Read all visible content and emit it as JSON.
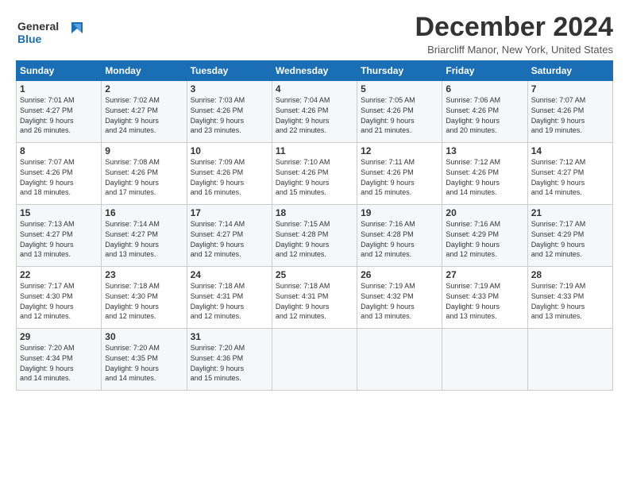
{
  "logo": {
    "line1": "General",
    "line2": "Blue"
  },
  "title": "December 2024",
  "location": "Briarcliff Manor, New York, United States",
  "weekdays": [
    "Sunday",
    "Monday",
    "Tuesday",
    "Wednesday",
    "Thursday",
    "Friday",
    "Saturday"
  ],
  "weeks": [
    [
      {
        "day": "1",
        "info": "Sunrise: 7:01 AM\nSunset: 4:27 PM\nDaylight: 9 hours\nand 26 minutes."
      },
      {
        "day": "2",
        "info": "Sunrise: 7:02 AM\nSunset: 4:27 PM\nDaylight: 9 hours\nand 24 minutes."
      },
      {
        "day": "3",
        "info": "Sunrise: 7:03 AM\nSunset: 4:26 PM\nDaylight: 9 hours\nand 23 minutes."
      },
      {
        "day": "4",
        "info": "Sunrise: 7:04 AM\nSunset: 4:26 PM\nDaylight: 9 hours\nand 22 minutes."
      },
      {
        "day": "5",
        "info": "Sunrise: 7:05 AM\nSunset: 4:26 PM\nDaylight: 9 hours\nand 21 minutes."
      },
      {
        "day": "6",
        "info": "Sunrise: 7:06 AM\nSunset: 4:26 PM\nDaylight: 9 hours\nand 20 minutes."
      },
      {
        "day": "7",
        "info": "Sunrise: 7:07 AM\nSunset: 4:26 PM\nDaylight: 9 hours\nand 19 minutes."
      }
    ],
    [
      {
        "day": "8",
        "info": "Sunrise: 7:07 AM\nSunset: 4:26 PM\nDaylight: 9 hours\nand 18 minutes."
      },
      {
        "day": "9",
        "info": "Sunrise: 7:08 AM\nSunset: 4:26 PM\nDaylight: 9 hours\nand 17 minutes."
      },
      {
        "day": "10",
        "info": "Sunrise: 7:09 AM\nSunset: 4:26 PM\nDaylight: 9 hours\nand 16 minutes."
      },
      {
        "day": "11",
        "info": "Sunrise: 7:10 AM\nSunset: 4:26 PM\nDaylight: 9 hours\nand 15 minutes."
      },
      {
        "day": "12",
        "info": "Sunrise: 7:11 AM\nSunset: 4:26 PM\nDaylight: 9 hours\nand 15 minutes."
      },
      {
        "day": "13",
        "info": "Sunrise: 7:12 AM\nSunset: 4:26 PM\nDaylight: 9 hours\nand 14 minutes."
      },
      {
        "day": "14",
        "info": "Sunrise: 7:12 AM\nSunset: 4:27 PM\nDaylight: 9 hours\nand 14 minutes."
      }
    ],
    [
      {
        "day": "15",
        "info": "Sunrise: 7:13 AM\nSunset: 4:27 PM\nDaylight: 9 hours\nand 13 minutes."
      },
      {
        "day": "16",
        "info": "Sunrise: 7:14 AM\nSunset: 4:27 PM\nDaylight: 9 hours\nand 13 minutes."
      },
      {
        "day": "17",
        "info": "Sunrise: 7:14 AM\nSunset: 4:27 PM\nDaylight: 9 hours\nand 12 minutes."
      },
      {
        "day": "18",
        "info": "Sunrise: 7:15 AM\nSunset: 4:28 PM\nDaylight: 9 hours\nand 12 minutes."
      },
      {
        "day": "19",
        "info": "Sunrise: 7:16 AM\nSunset: 4:28 PM\nDaylight: 9 hours\nand 12 minutes."
      },
      {
        "day": "20",
        "info": "Sunrise: 7:16 AM\nSunset: 4:29 PM\nDaylight: 9 hours\nand 12 minutes."
      },
      {
        "day": "21",
        "info": "Sunrise: 7:17 AM\nSunset: 4:29 PM\nDaylight: 9 hours\nand 12 minutes."
      }
    ],
    [
      {
        "day": "22",
        "info": "Sunrise: 7:17 AM\nSunset: 4:30 PM\nDaylight: 9 hours\nand 12 minutes."
      },
      {
        "day": "23",
        "info": "Sunrise: 7:18 AM\nSunset: 4:30 PM\nDaylight: 9 hours\nand 12 minutes."
      },
      {
        "day": "24",
        "info": "Sunrise: 7:18 AM\nSunset: 4:31 PM\nDaylight: 9 hours\nand 12 minutes."
      },
      {
        "day": "25",
        "info": "Sunrise: 7:18 AM\nSunset: 4:31 PM\nDaylight: 9 hours\nand 12 minutes."
      },
      {
        "day": "26",
        "info": "Sunrise: 7:19 AM\nSunset: 4:32 PM\nDaylight: 9 hours\nand 13 minutes."
      },
      {
        "day": "27",
        "info": "Sunrise: 7:19 AM\nSunset: 4:33 PM\nDaylight: 9 hours\nand 13 minutes."
      },
      {
        "day": "28",
        "info": "Sunrise: 7:19 AM\nSunset: 4:33 PM\nDaylight: 9 hours\nand 13 minutes."
      }
    ],
    [
      {
        "day": "29",
        "info": "Sunrise: 7:20 AM\nSunset: 4:34 PM\nDaylight: 9 hours\nand 14 minutes."
      },
      {
        "day": "30",
        "info": "Sunrise: 7:20 AM\nSunset: 4:35 PM\nDaylight: 9 hours\nand 14 minutes."
      },
      {
        "day": "31",
        "info": "Sunrise: 7:20 AM\nSunset: 4:36 PM\nDaylight: 9 hours\nand 15 minutes."
      },
      {
        "day": "",
        "info": ""
      },
      {
        "day": "",
        "info": ""
      },
      {
        "day": "",
        "info": ""
      },
      {
        "day": "",
        "info": ""
      }
    ]
  ]
}
